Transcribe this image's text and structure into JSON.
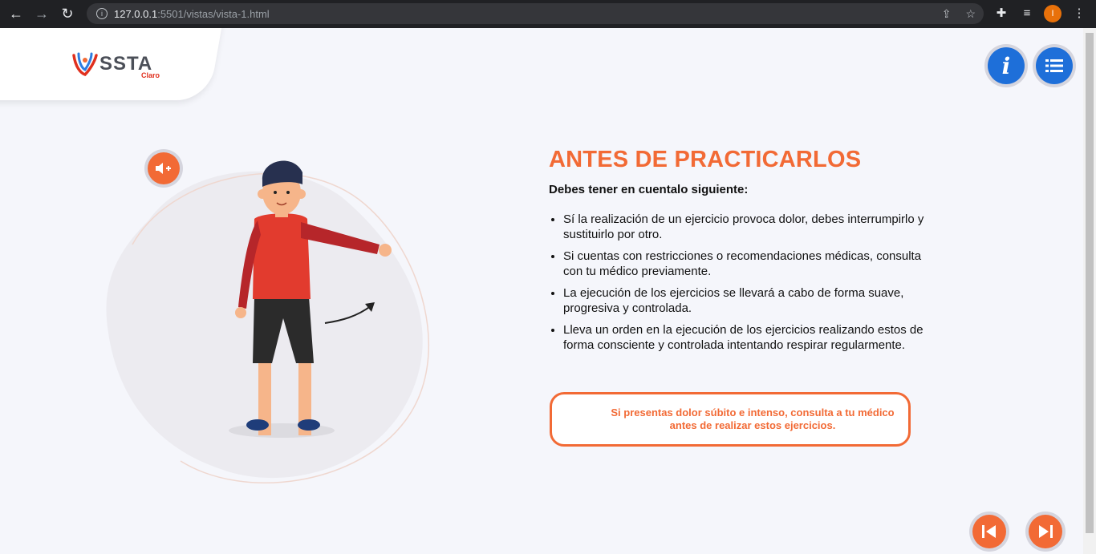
{
  "browser": {
    "url_host": "127.0.0.1",
    "url_path": ":5501/vistas/vista-1.html",
    "profile_initial": "I"
  },
  "logo": {
    "brand": "SSTA",
    "sub": "Claro"
  },
  "header_buttons": {
    "info": "i",
    "menu_icon": "list-icon"
  },
  "main": {
    "title": "ANTES DE PRACTICARLOS",
    "subtitle": "Debes tener en cuentalo siguiente:",
    "items": [
      "Sí la realización de un ejercicio provoca dolor, debes interrumpirlo y sustituirlo por otro.",
      "Si cuentas con restricciones o recomendaciones médicas, consulta con tu médico previamente.",
      "La ejecución de los ejercicios se llevará a cabo de forma suave, progresiva y controlada.",
      "Lleva un orden en la ejecución de los ejercicios realizando estos de forma consciente y controlada intentando respirar regularmente."
    ],
    "warning": "Si presentas dolor súbito e intenso, consulta a tu médico antes de realizar estos ejercicios."
  },
  "colors": {
    "accent": "#f26a35",
    "blue": "#1e6fd9"
  }
}
